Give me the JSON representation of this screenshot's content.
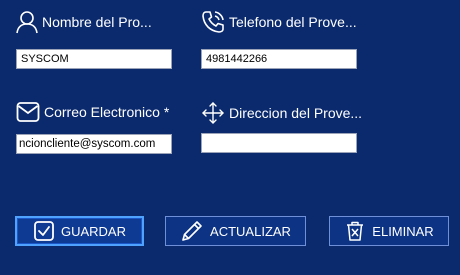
{
  "form": {
    "nombre": {
      "label": "Nombre del Pro...",
      "value": "SYSCOM",
      "icon": "person-icon"
    },
    "telefono": {
      "label": "Telefono del Prove...",
      "value": "4981442266",
      "icon": "phone-icon"
    },
    "correo": {
      "label": "Correo Electronico *",
      "value": "ncioncliente@syscom.com",
      "icon": "envelope-icon"
    },
    "direccion": {
      "label": "Direccion del Prove...",
      "value": "",
      "icon": "move-arrows-icon"
    }
  },
  "buttons": {
    "guardar": {
      "label": "GUARDAR",
      "icon": "checkbox-icon"
    },
    "actualizar": {
      "label": "ACTUALIZAR",
      "icon": "pencil-icon"
    },
    "eliminar": {
      "label": "ELIMINAR",
      "icon": "trash-icon"
    }
  },
  "colors": {
    "background": "#0b2a6e",
    "button": "#0d3384",
    "accent": "#4fa3ff"
  }
}
